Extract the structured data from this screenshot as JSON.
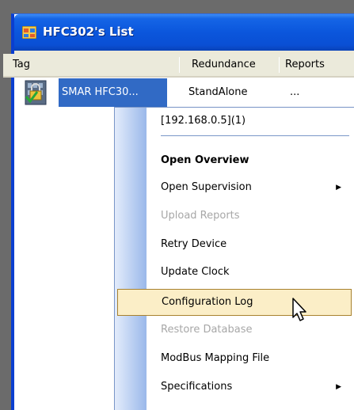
{
  "window": {
    "title": "HFC302's List"
  },
  "columns": [
    "Tag",
    "Redundance",
    "Reports"
  ],
  "rows": [
    {
      "tag": "SMAR HFC30...",
      "redundance": "StandAlone",
      "reports": "..."
    }
  ],
  "context_menu": {
    "header": "[192.168.0.5](1)",
    "items": [
      {
        "label": "Open Overview",
        "bold": true,
        "disabled": false,
        "submenu": false
      },
      {
        "label": "Open Supervision",
        "bold": false,
        "disabled": false,
        "submenu": true
      },
      {
        "label": "Upload Reports",
        "bold": false,
        "disabled": true,
        "submenu": false
      },
      {
        "label": "Retry Device",
        "bold": false,
        "disabled": false,
        "submenu": false
      },
      {
        "label": "Update Clock",
        "bold": false,
        "disabled": false,
        "submenu": false
      },
      {
        "label": "Configuration Log",
        "bold": false,
        "disabled": false,
        "submenu": false,
        "highlighted": true
      },
      {
        "label": "Restore Database",
        "bold": false,
        "disabled": true,
        "submenu": false
      },
      {
        "label": "ModBus Mapping File",
        "bold": false,
        "disabled": false,
        "submenu": false
      },
      {
        "label": "Specifications",
        "bold": false,
        "disabled": false,
        "submenu": true
      }
    ]
  },
  "icons": {
    "app": "app-window-icon",
    "device": "locked-device-icon",
    "submenu": "submenu-arrow-icon",
    "pointer": "mouse-pointer-icon"
  },
  "colors": {
    "title_bar": "#0b56dc",
    "selection": "#316ac5",
    "menu_hover": "#fbeec7",
    "disabled_text": "#a7a7a7"
  }
}
